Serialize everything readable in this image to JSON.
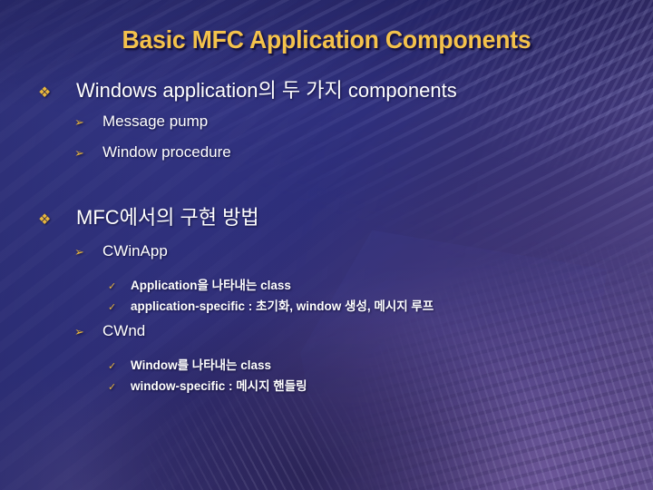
{
  "slide": {
    "title": "Basic MFC Application Components",
    "theme": {
      "title_color": "#F4C24B",
      "bullet_color": "#E8B63C",
      "text_color": "#FFFFFF",
      "background_blue": "#33357F",
      "background_purple": "#6B5796"
    },
    "bullets": {
      "diamond": "❖",
      "arrow": "➢",
      "check": "✓"
    },
    "outline": [
      {
        "level": 1,
        "icon": "diamond",
        "text": "Windows application의 두 가지 components"
      },
      {
        "level": 2,
        "icon": "arrow",
        "text": "Message pump"
      },
      {
        "level": 2,
        "icon": "arrow",
        "text": "Window procedure"
      },
      {
        "level": 1,
        "icon": "diamond",
        "text": "MFC에서의 구현 방법"
      },
      {
        "level": 2,
        "icon": "arrow",
        "text": "CWinApp"
      },
      {
        "level": 3,
        "icon": "check",
        "text": "Application을 나타내는 class"
      },
      {
        "level": 3,
        "icon": "check",
        "text": "application-specific : 초기화, window 생성, 메시지 루프"
      },
      {
        "level": 2,
        "icon": "arrow",
        "text": "CWnd"
      },
      {
        "level": 3,
        "icon": "check",
        "text": "Window를 나타내는 class"
      },
      {
        "level": 3,
        "icon": "check",
        "text": "window-specific : 메시지 핸들링"
      }
    ]
  }
}
